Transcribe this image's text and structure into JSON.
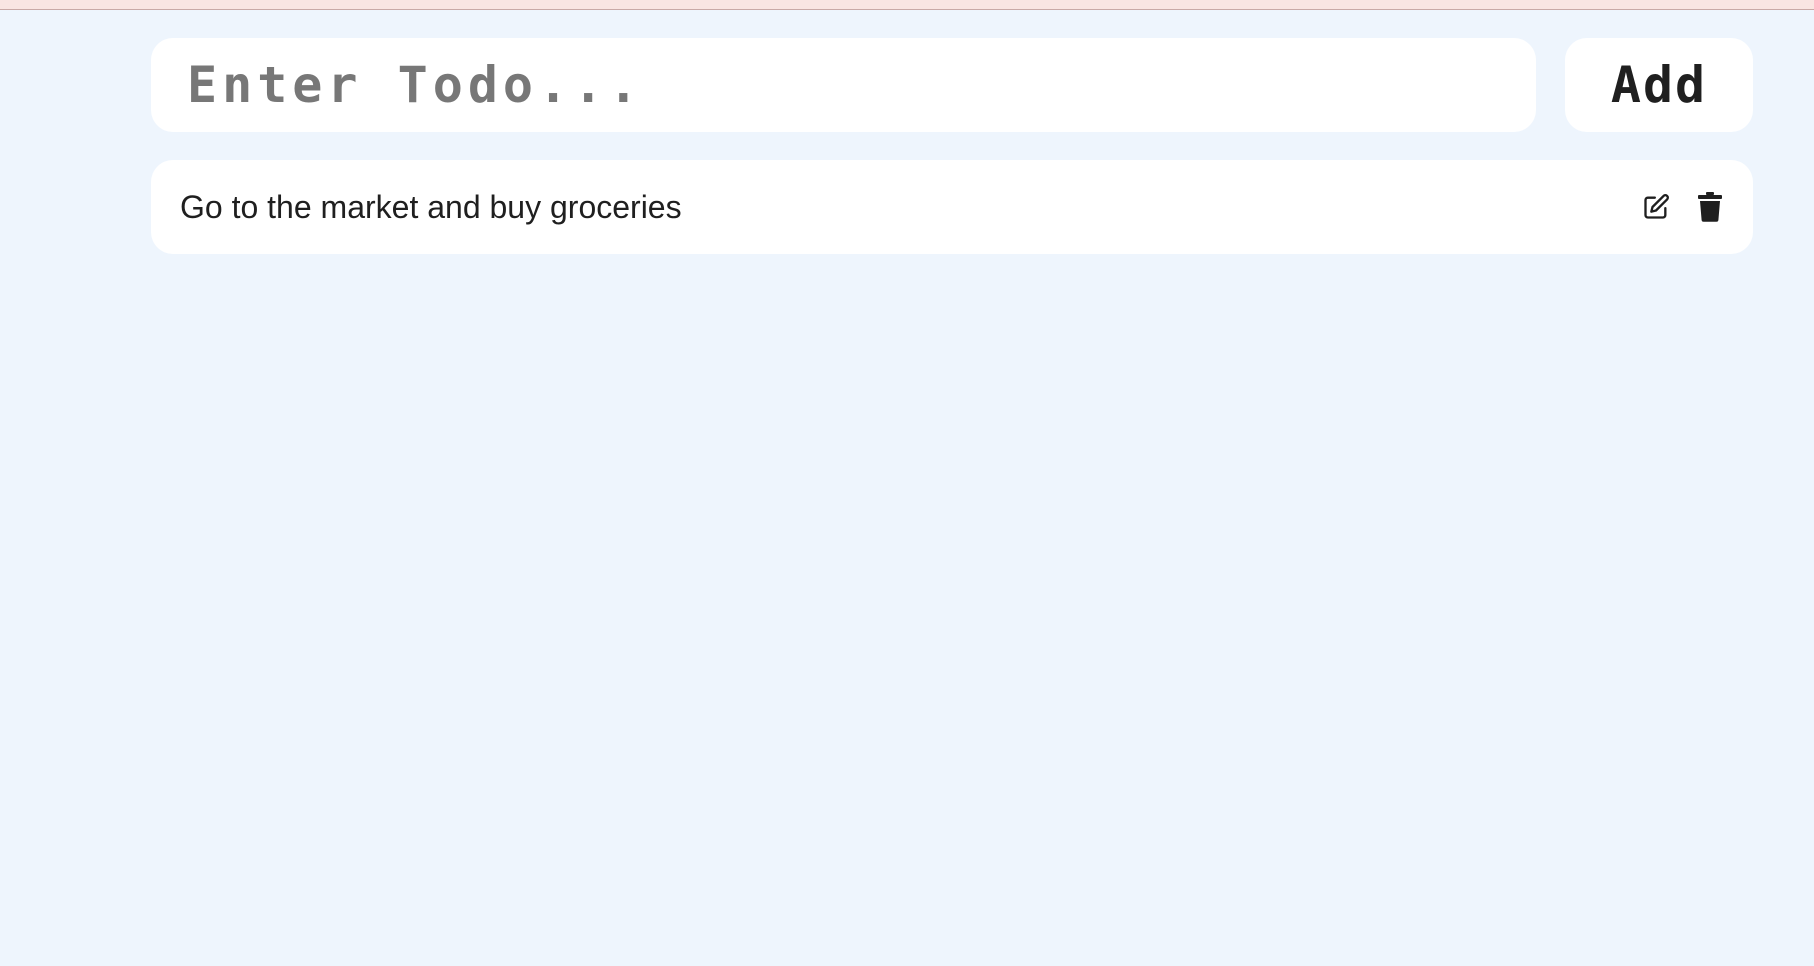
{
  "form": {
    "input_value": "",
    "input_placeholder": "Enter Todo...",
    "add_label": "Add"
  },
  "todos": [
    {
      "text": "Go to the market and buy groceries",
      "edit_icon": "edit-icon",
      "delete_icon": "trash-icon"
    }
  ],
  "colors": {
    "background": "#eef5fd",
    "card": "#ffffff",
    "text": "#1f1f1f",
    "placeholder": "#777777",
    "top_strip": "#f9e5e2"
  }
}
